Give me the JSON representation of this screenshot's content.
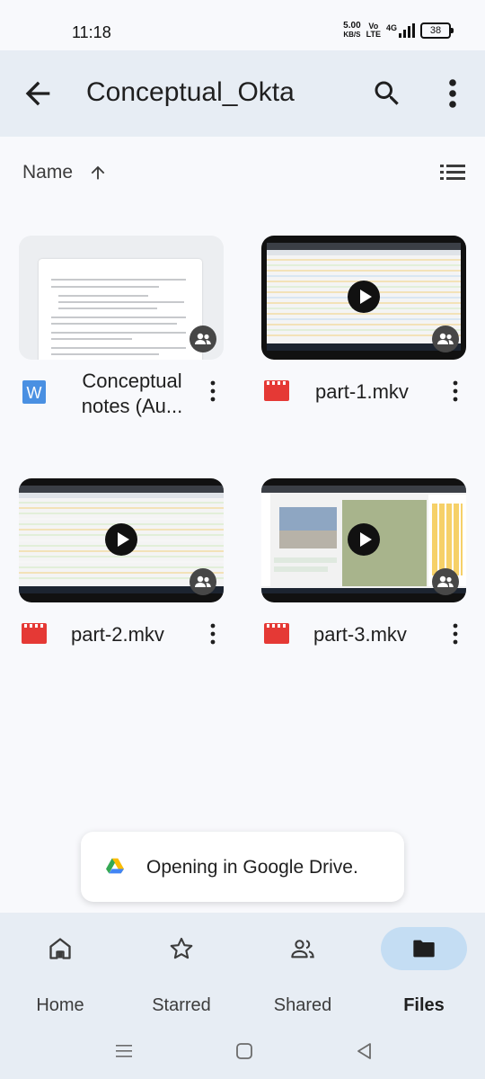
{
  "status_bar": {
    "time": "11:18",
    "net_speed_value": "5.00",
    "net_speed_unit": "KB/S",
    "volte_top": "Vo",
    "volte_bottom": "LTE",
    "network": "4G",
    "battery": "38"
  },
  "app_bar": {
    "title": "Conceptual_Okta",
    "back_icon": "arrow-back-icon",
    "search_icon": "search-icon",
    "more_icon": "more-vert-icon"
  },
  "sort": {
    "label": "Name",
    "direction_icon": "arrow-upward-icon",
    "view_icon": "list-view-icon"
  },
  "files": [
    {
      "name": "Conceptual notes (Au...",
      "type": "word-doc",
      "shared": true
    },
    {
      "name": "part-1.mkv",
      "type": "video",
      "shared": true
    },
    {
      "name": "part-2.mkv",
      "type": "video",
      "shared": true
    },
    {
      "name": "part-3.mkv",
      "type": "video",
      "shared": true
    }
  ],
  "file_name_lines": [
    "Conceptual",
    "notes (Au..."
  ],
  "toast": {
    "text": "Opening in Google Drive.",
    "icon": "google-drive-icon"
  },
  "bottom_nav": {
    "items": [
      {
        "label": "Home",
        "icon": "home-icon",
        "active": false
      },
      {
        "label": "Starred",
        "icon": "star-icon",
        "active": false
      },
      {
        "label": "Shared",
        "icon": "people-icon",
        "active": false
      },
      {
        "label": "Files",
        "icon": "folder-icon",
        "active": true
      }
    ]
  },
  "colors": {
    "accent": "#c4ddf3",
    "app_bar": "#e7edf4",
    "word": "#4a90e2",
    "video": "#e53935"
  }
}
